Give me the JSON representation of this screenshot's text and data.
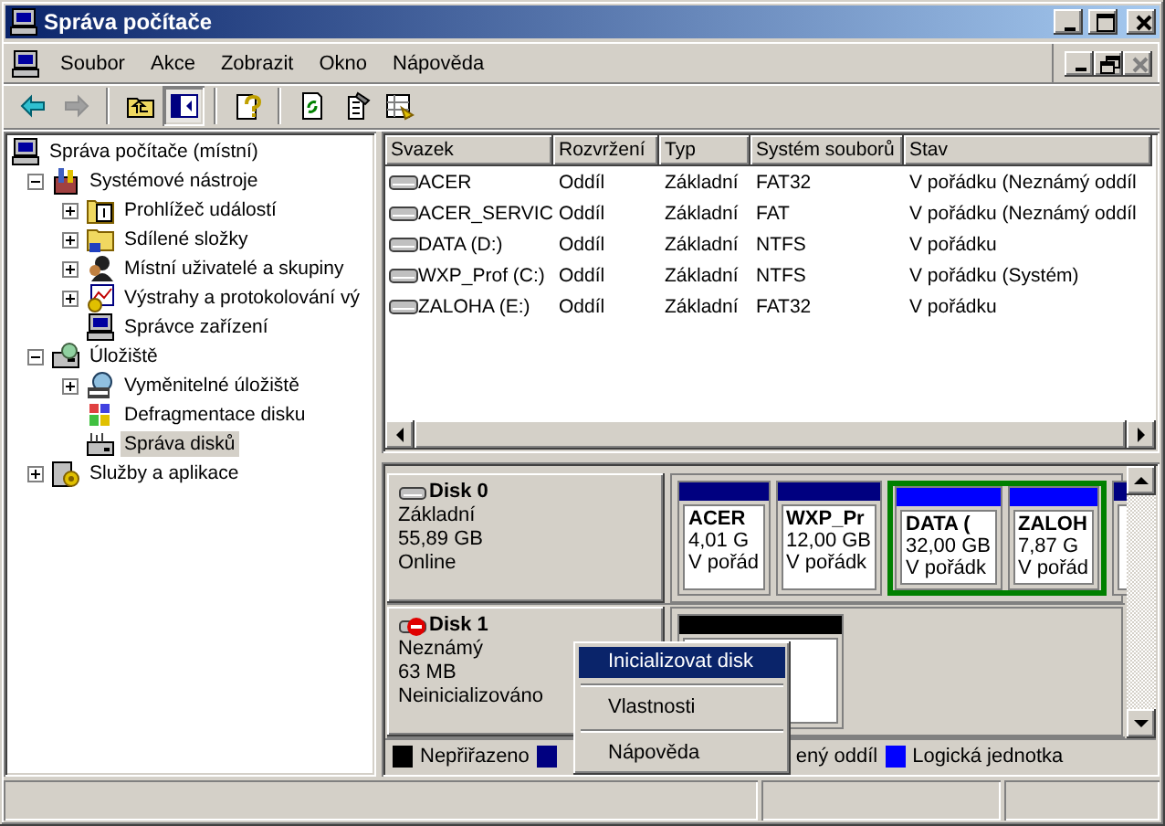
{
  "window": {
    "title": "Správa počítače"
  },
  "menu": [
    "Soubor",
    "Akce",
    "Zobrazit",
    "Okno",
    "Nápověda"
  ],
  "mdi_buttons": [
    {
      "kind": "minimize",
      "disabled": false
    },
    {
      "kind": "restore",
      "disabled": false
    },
    {
      "kind": "close",
      "disabled": true
    }
  ],
  "toolbar": [
    {
      "kind": "back",
      "disabled": false,
      "pressed": false
    },
    {
      "kind": "forward",
      "disabled": true,
      "pressed": false
    },
    {
      "kind": "separator"
    },
    {
      "kind": "up",
      "disabled": false,
      "pressed": false
    },
    {
      "kind": "tree",
      "disabled": false,
      "pressed": true
    },
    {
      "kind": "separator"
    },
    {
      "kind": "help",
      "disabled": false,
      "pressed": false
    },
    {
      "kind": "separator"
    },
    {
      "kind": "refresh",
      "disabled": false,
      "pressed": false
    },
    {
      "kind": "properties",
      "disabled": false,
      "pressed": false
    },
    {
      "kind": "export",
      "disabled": false,
      "pressed": false
    }
  ],
  "tree": [
    {
      "label": "Správa počítače (místní)",
      "kind": "computer",
      "selected": false,
      "children": [
        {
          "label": "Systémové nástroje",
          "kind": "tools",
          "selected": false,
          "expanded": true,
          "children": [
            {
              "label": "Prohlížeč událostí",
              "kind": "log",
              "selected": false,
              "expanded": false
            },
            {
              "label": "Sdílené složky",
              "kind": "folder",
              "selected": false,
              "expanded": false
            },
            {
              "label": "Místní uživatelé a skupiny",
              "kind": "users",
              "selected": false,
              "expanded": false
            },
            {
              "label": "Výstrahy a protokolování vý",
              "kind": "chart",
              "selected": false,
              "expanded": false
            },
            {
              "label": "Správce zařízení",
              "kind": "device",
              "selected": false
            }
          ]
        },
        {
          "label": "Úložiště",
          "kind": "storage",
          "selected": false,
          "expanded": true,
          "children": [
            {
              "label": "Vyměnitelné úložiště",
              "kind": "removable",
              "selected": false,
              "expanded": false
            },
            {
              "label": "Defragmentace disku",
              "kind": "defrag",
              "selected": false
            },
            {
              "label": "Správa disků",
              "kind": "diskmgmt",
              "selected": true
            }
          ]
        },
        {
          "label": "Služby a aplikace",
          "kind": "services",
          "selected": false,
          "expanded": false
        }
      ]
    }
  ],
  "volumes": {
    "columns": [
      "Svazek",
      "Rozvržení",
      "Typ",
      "Systém souborů",
      "Stav"
    ],
    "rows": [
      [
        "ACER",
        "Oddíl",
        "Základní",
        "FAT32",
        "V pořádku (Neznámý oddíl"
      ],
      [
        "ACER_SERVIC",
        "Oddíl",
        "Základní",
        "FAT",
        "V pořádku (Neznámý oddíl"
      ],
      [
        "DATA (D:)",
        "Oddíl",
        "Základní",
        "NTFS",
        "V pořádku"
      ],
      [
        "WXP_Prof (C:)",
        "Oddíl",
        "Základní",
        "NTFS",
        "V pořádku (Systém)"
      ],
      [
        "ZALOHA (E:)",
        "Oddíl",
        "Základní",
        "FAT32",
        "V pořádku"
      ]
    ]
  },
  "disks": [
    {
      "name": "Disk 0",
      "kind": "basic",
      "lines": [
        "Základní",
        "55,89 GB",
        "Online"
      ],
      "partitions": [
        {
          "kind": "primary",
          "lines": [
            "ACER",
            "4,01 G",
            "V pořád"
          ]
        },
        {
          "kind": "primary",
          "lines": [
            "WXP_Pr",
            "12,00 GB",
            "V pořádk"
          ]
        },
        {
          "kind": "extended",
          "children": [
            {
              "kind": "logical",
              "lines": [
                "DATA (",
                "32,00 GB",
                "V pořádk"
              ]
            },
            {
              "kind": "logical",
              "lines": [
                "ZALOH",
                "7,87 G",
                "V pořád"
              ]
            }
          ]
        },
        {
          "kind": "primary"
        }
      ]
    },
    {
      "name": "Disk 1",
      "kind": "unknown",
      "lines": [
        "Neznámý",
        "63 MB",
        "Neinicializováno"
      ],
      "partitions": [
        {
          "kind": "unallocated"
        }
      ]
    }
  ],
  "legend": [
    {
      "label": "Nepřiřazeno",
      "color": "#000000"
    },
    {
      "color": "#000080"
    },
    {
      "label": "ený oddíl"
    },
    {
      "label": "Logická jednotka",
      "color": "#0000ff"
    }
  ],
  "context_menu": [
    {
      "kind": "item",
      "label": "Inicializovat disk",
      "selected": true
    },
    {
      "kind": "separator"
    },
    {
      "kind": "item",
      "label": "Vlastnosti",
      "selected": false
    },
    {
      "kind": "separator"
    },
    {
      "kind": "item",
      "label": "Nápověda",
      "selected": false
    }
  ]
}
